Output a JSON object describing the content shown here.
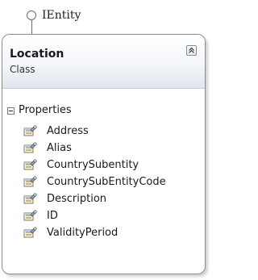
{
  "interface": {
    "name": "IEntity"
  },
  "class": {
    "name": "Location",
    "kind": "Class",
    "collapse_icon": "double-chevron-up-icon"
  },
  "compartment": {
    "label": "Properties",
    "toggle_icon": "minus-box-icon",
    "property_icon": "property-wrench-icon",
    "items": [
      {
        "label": "Address"
      },
      {
        "label": "Alias"
      },
      {
        "label": "CountrySubentity"
      },
      {
        "label": "CountrySubEntityCode"
      },
      {
        "label": "Description"
      },
      {
        "label": "ID"
      },
      {
        "label": "ValidityPeriod"
      }
    ]
  },
  "colors": {
    "header_gradient_end": "#dfe5ee",
    "border": "#8c8c8c"
  }
}
